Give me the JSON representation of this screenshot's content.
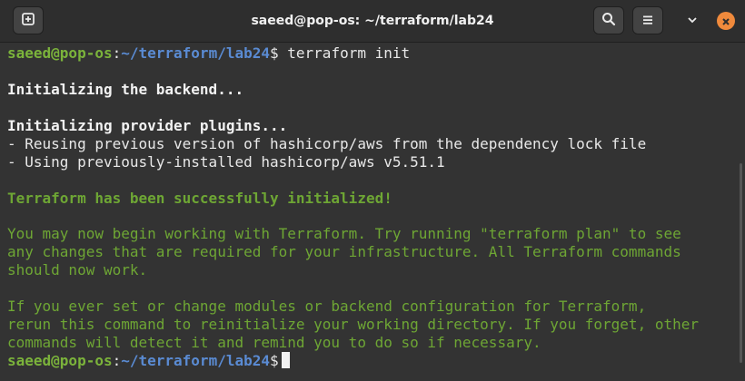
{
  "window": {
    "title": "saeed@pop-os: ~/terraform/lab24"
  },
  "icons": {
    "new_tab": "new-tab-icon",
    "search": "search-icon",
    "menu": "hamburger-menu-icon",
    "close": "close-icon"
  },
  "colors": {
    "background": "#333333",
    "prompt_user": "#7bb33b",
    "prompt_path": "#5a8bd3",
    "success_text": "#6ea634",
    "close_button": "#f08a3c"
  },
  "prompt": {
    "user_host": "saeed@pop-os",
    "separator": ":",
    "path": "~/terraform/lab24",
    "symbol": "$"
  },
  "terminal": {
    "command": " terraform init",
    "lines": [
      "Initializing the backend...",
      "Initializing provider plugins...",
      "- Reusing previous version of hashicorp/aws from the dependency lock file",
      "- Using previously-installed hashicorp/aws v5.51.1",
      "Terraform has been successfully initialized!",
      "You may now begin working with Terraform. Try running \"terraform plan\" to see",
      "any changes that are required for your infrastructure. All Terraform commands",
      "should now work.",
      "If you ever set or change modules or backend configuration for Terraform,",
      "rerun this command to reinitialize your working directory. If you forget, other",
      "commands will detect it and remind you to do so if necessary."
    ]
  }
}
